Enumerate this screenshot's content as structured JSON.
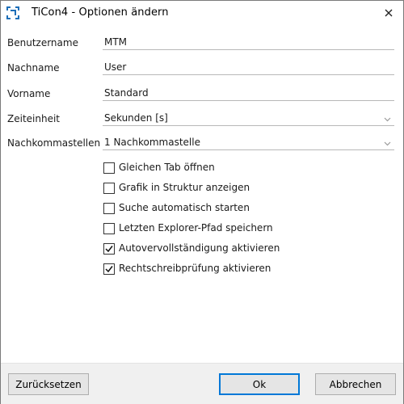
{
  "window": {
    "title": "TiCon4 - Optionen ändern"
  },
  "fields": {
    "username": {
      "label": "Benutzername",
      "value": "MTM"
    },
    "lastname": {
      "label": "Nachname",
      "value": "User"
    },
    "firstname": {
      "label": "Vorname",
      "value": "Standard"
    },
    "time_unit": {
      "label": "Zeiteinheit",
      "value": "Sekunden [s]"
    },
    "decimals": {
      "label": "Nachkommastellen",
      "value": "1 Nachkommastelle"
    }
  },
  "checkboxes": [
    {
      "label": "Gleichen Tab öffnen",
      "checked": false
    },
    {
      "label": "Grafik in Struktur anzeigen",
      "checked": false
    },
    {
      "label": "Suche automatisch starten",
      "checked": false
    },
    {
      "label": "Letzten Explorer-Pfad speichern",
      "checked": false
    },
    {
      "label": "Autovervollständigung aktivieren",
      "checked": true
    },
    {
      "label": "Rechtschreibprüfung aktivieren",
      "checked": true
    }
  ],
  "buttons": {
    "reset": "Zurücksetzen",
    "ok": "Ok",
    "cancel": "Abbrechen"
  },
  "colors": {
    "accent": "#0078d7",
    "icon": "#1e6fb8",
    "footer_bg": "#f0f0f0"
  }
}
